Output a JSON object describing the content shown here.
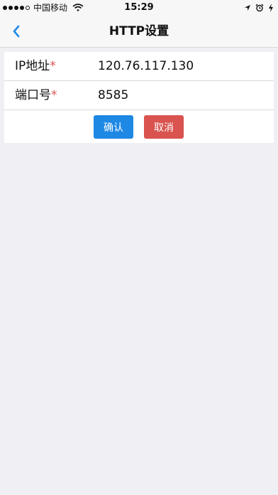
{
  "status_bar": {
    "carrier": "中国移动",
    "time": "15:29"
  },
  "nav": {
    "title": "HTTP设置"
  },
  "form": {
    "ip": {
      "label": "IP地址",
      "required_mark": "*",
      "value": "120.76.117.130"
    },
    "port": {
      "label": "端口号",
      "required_mark": "*",
      "value": "8585"
    },
    "confirm_label": "确认",
    "cancel_label": "取消"
  },
  "colors": {
    "accent": "#1e88e5",
    "danger": "#d9534f",
    "background": "#efeff4"
  }
}
